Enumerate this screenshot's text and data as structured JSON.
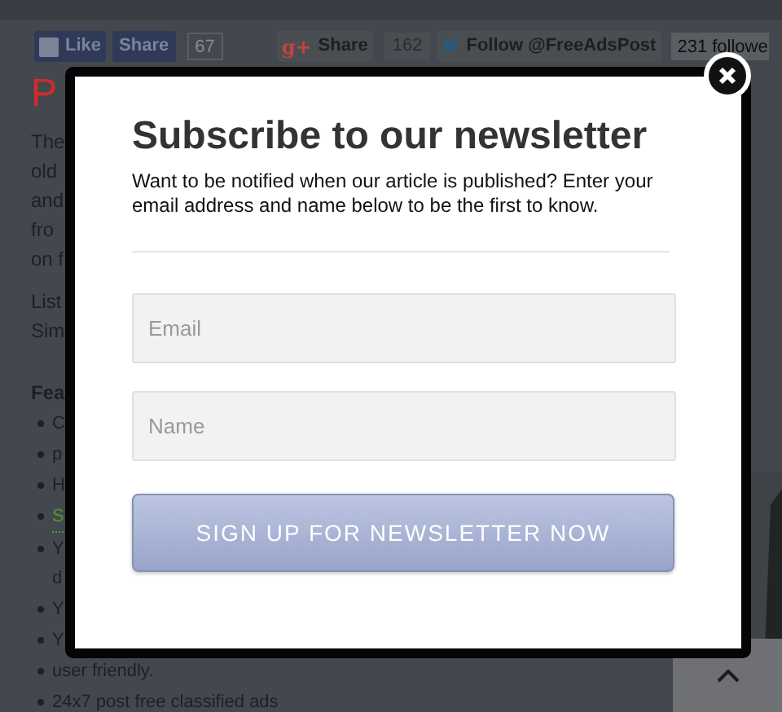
{
  "social_bar": {
    "like": "Like",
    "share": "Share",
    "share_count": "67",
    "gplus_icon": "g+",
    "gplus_share": "Share",
    "gplus_count": "162",
    "twitter_follow": "Follow @FreeAdsPost",
    "twitter_count": "231 followe"
  },
  "page": {
    "heading": "P",
    "intro_lines": [
      "The",
      "old",
      "and",
      "fro",
      "on f"
    ],
    "list_lines": [
      "List",
      "Sim"
    ],
    "features_heading": "Fea",
    "features": [
      {
        "text": "C",
        "kind": "plain"
      },
      {
        "text": "p",
        "kind": "plain"
      },
      {
        "text": "H",
        "kind": "plain"
      },
      {
        "text": "S",
        "kind": "link"
      },
      {
        "text": "Y",
        "kind": "plain",
        "continuation": "d"
      },
      {
        "text": "Y",
        "kind": "plain"
      },
      {
        "text": "Y",
        "kind": "plain"
      },
      {
        "text": "user friendly.",
        "kind": "plain"
      },
      {
        "text": "24x7 post free classified ads",
        "kind": "plain"
      }
    ]
  },
  "modal": {
    "title": "Subscribe to our newsletter",
    "description": "Want to be notified when our article is published? Enter your email address and name below to be the first to know.",
    "fields": [
      {
        "placeholder": "Email"
      },
      {
        "placeholder": "Name"
      }
    ],
    "submit": "SIGN UP FOR NEWSLETTER NOW"
  }
}
